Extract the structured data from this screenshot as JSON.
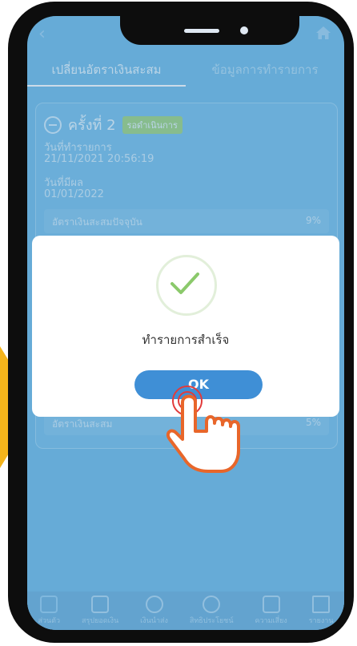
{
  "tabs": [
    {
      "label": "เปลี่ยนอัตราเงินสะสม",
      "active": true
    },
    {
      "label": "ข้อมูลการทำรายการ",
      "active": false
    }
  ],
  "card": {
    "round_label": "ครั้งที่ 2",
    "status_badge": "รอดำเนินการ",
    "transaction_date_label": "วันที่ทำรายการ",
    "transaction_date": "21/11/2021 20:56:19",
    "effective_date_label": "วันที่มีผล",
    "effective_date": "01/01/2022",
    "current_rate_label": "อัตราเงินสะสมปัจจุบัน",
    "current_rate_value": "9%",
    "new_rate_label": "อัตราเงินสะสม",
    "new_rate_value": "5%"
  },
  "dialog": {
    "message": "ทำรายการสำเร็จ",
    "ok_label": "OK"
  },
  "bottom_nav": [
    {
      "label": "ส่วนตัว",
      "icon": "profile-icon",
      "active": true
    },
    {
      "label": "สรุปยอดเงิน",
      "icon": "document-icon",
      "active": false
    },
    {
      "label": "เงินนำส่ง",
      "icon": "coin-icon",
      "active": false
    },
    {
      "label": "สิทธิประโยชน์",
      "icon": "exchange-icon",
      "active": false
    },
    {
      "label": "ความเสี่ยง",
      "icon": "report-icon",
      "active": false
    },
    {
      "label": "รายงาน",
      "icon": "download-icon",
      "active": false
    }
  ],
  "colors": {
    "accent_arrow": "#f5b41b",
    "screen_bg": "#7ec2ea",
    "ok_button": "#3f8fd6",
    "check_green": "#8bc96b"
  }
}
